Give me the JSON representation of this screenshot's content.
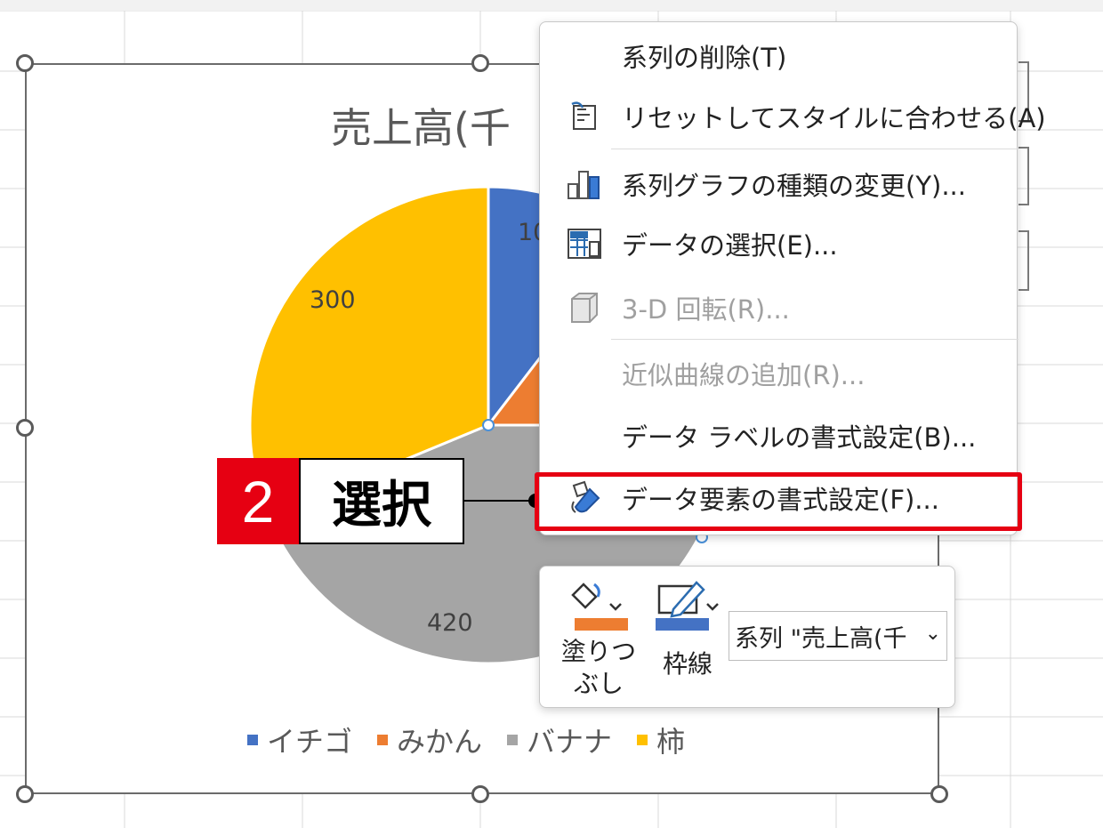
{
  "chart": {
    "title": "売上高(千",
    "legend": [
      {
        "label": "イチゴ",
        "color": "#4472C4"
      },
      {
        "label": "みかん",
        "color": "#ED7D31"
      },
      {
        "label": "バナナ",
        "color": "#A5A5A5"
      },
      {
        "label": "柿",
        "color": "#FFC000"
      }
    ],
    "labels": {
      "ichigo": "10",
      "banana": "420",
      "kaki": "300"
    }
  },
  "chart_data": {
    "type": "pie",
    "title": "売上高(千",
    "categories": [
      "イチゴ",
      "みかん",
      "バナナ",
      "柿"
    ],
    "values": [
      100,
      140,
      420,
      300
    ],
    "colors": [
      "#4472C4",
      "#ED7D31",
      "#A5A5A5",
      "#FFC000"
    ],
    "legend": "bottom"
  },
  "callout": {
    "number": "2",
    "text": "選択"
  },
  "menu": {
    "items": [
      {
        "label": "系列の削除(T)",
        "disabled": false
      },
      {
        "label": "リセットしてスタイルに合わせる(A)",
        "disabled": false
      },
      {
        "label": "系列グラフの種類の変更(Y)...",
        "disabled": false
      },
      {
        "label": "データの選択(E)...",
        "disabled": false
      },
      {
        "label": "3-D 回転(R)...",
        "disabled": true
      },
      {
        "label": "近似曲線の追加(R)...",
        "disabled": true
      },
      {
        "label": "データ ラベルの書式設定(B)...",
        "disabled": false
      },
      {
        "label": "データ要素の書式設定(F)...",
        "disabled": false
      }
    ]
  },
  "toolbar": {
    "fill_label_1": "塗りつ",
    "fill_label_2": "ぶし",
    "outline_label": "枠線",
    "series_select": "系列 \"売上高(千",
    "fill_color": "#ED7D31",
    "outline_color": "#4472C4"
  }
}
